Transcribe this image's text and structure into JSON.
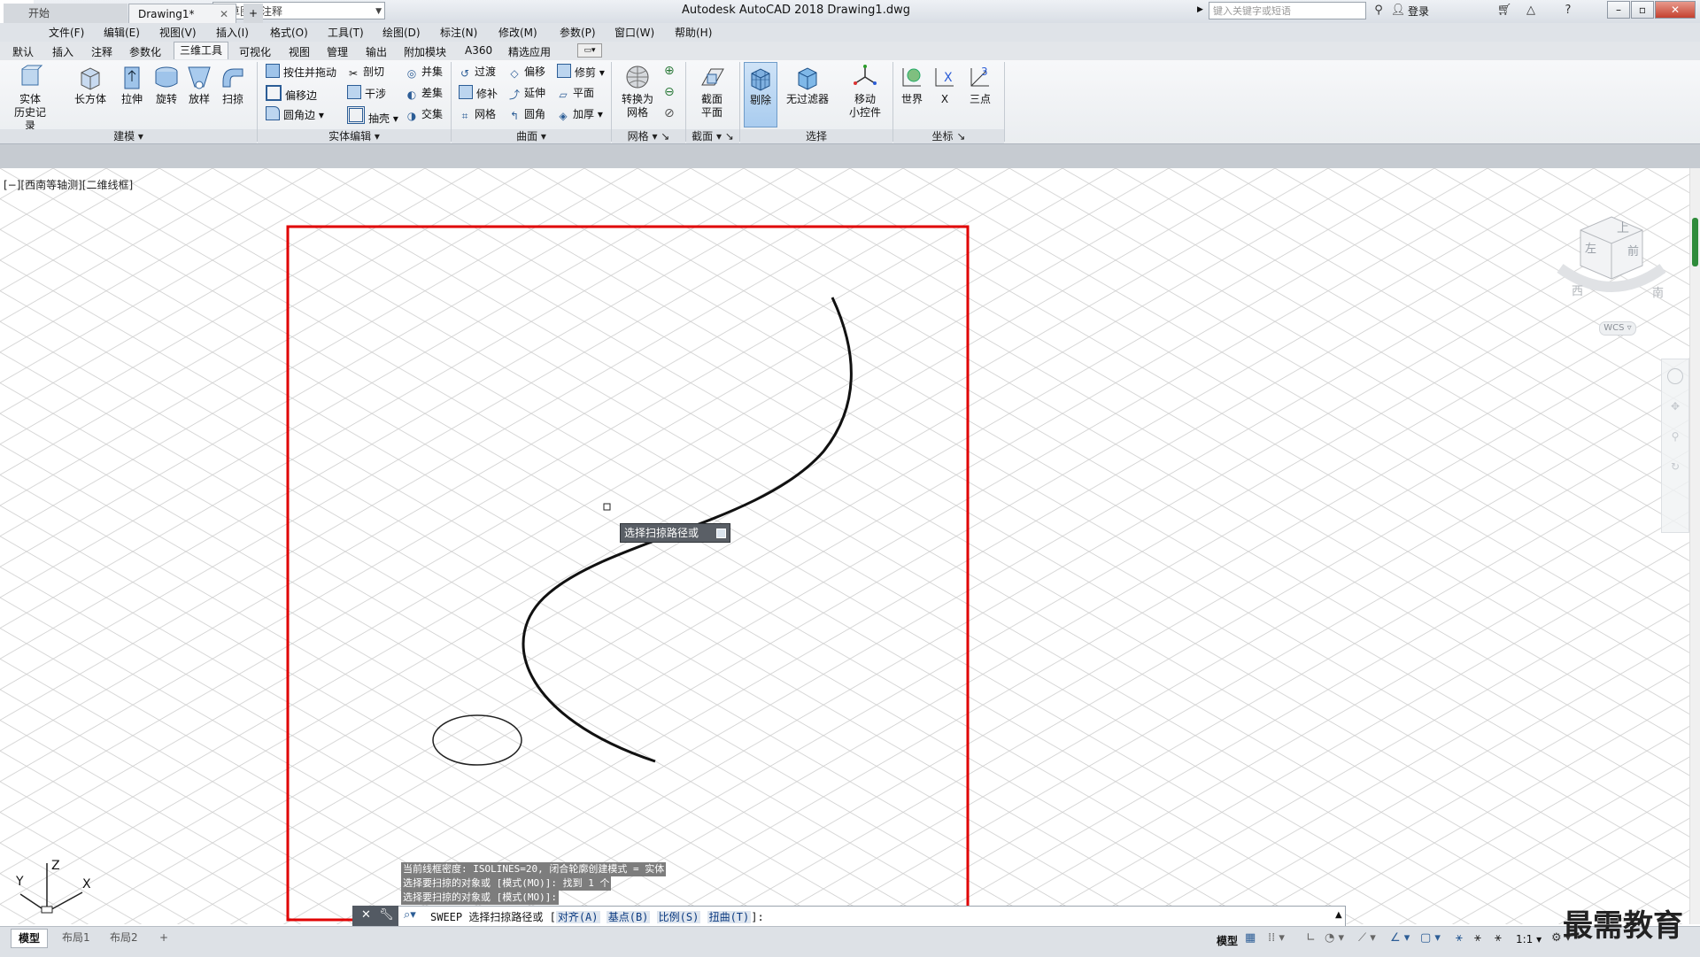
{
  "app": {
    "title": "Autodesk AutoCAD 2018    Drawing1.dwg",
    "workspace": "草图与注释",
    "search_placeholder": "键入关键字或短语",
    "login": "登录"
  },
  "menu": [
    "文件(F)",
    "编辑(E)",
    "视图(V)",
    "插入(I)",
    "格式(O)",
    "工具(T)",
    "绘图(D)",
    "标注(N)",
    "修改(M)",
    "参数(P)",
    "窗口(W)",
    "帮助(H)"
  ],
  "ribbon_tabs": [
    "默认",
    "插入",
    "注释",
    "参数化",
    "三维工具",
    "可视化",
    "视图",
    "管理",
    "输出",
    "附加模块",
    "A360",
    "精选应用"
  ],
  "ribbon_active_tab": "三维工具",
  "ribbon": {
    "history": "实体\n历史记录",
    "box": "长方体",
    "extrude": "拉伸",
    "revolve": "旋转",
    "loft": "放样",
    "sweep": "扫掠",
    "modeling_label": "建模",
    "press_pull": "按住并拖动",
    "offset_edge": "偏移边",
    "fillet_edge": "圆角边",
    "slice": "剖切",
    "interfere": "干涉",
    "shell": "抽壳",
    "union": "并集",
    "subtract": "差集",
    "intersect": "交集",
    "solid_edit_label": "实体编辑",
    "blend": "过渡",
    "patch": "修补",
    "network": "网格",
    "offset": "偏移",
    "extend": "延伸",
    "fillet": "圆角",
    "trim": "修剪",
    "planar": "平面",
    "thicken": "加厚",
    "surface_label": "曲面",
    "convert_mesh": "转换为\n网格",
    "mesh_label": "网格",
    "section_plane": "截面\n平面",
    "section_label": "截面",
    "culling": "剔除",
    "no_filter": "无过滤器",
    "move_gizmo": "移动\n小控件",
    "select_label": "选择",
    "world": "世界",
    "x": "X",
    "three_point": "三点",
    "coords_label": "坐标"
  },
  "file_tabs": {
    "start": "开始",
    "drawing": "Drawing1*"
  },
  "viewport_label": "[−][西南等轴测][二维线框]",
  "tooltip": "选择扫掠路径或",
  "viewcube": {
    "top": "上",
    "left": "左",
    "front": "前",
    "west": "西",
    "south": "南",
    "wcs": "WCS"
  },
  "ucs": {
    "x": "X",
    "y": "Y",
    "z": "Z"
  },
  "command": {
    "history": [
      "当前线框密度:  ISOLINES=20, 闭合轮廓创建模式 = 实体",
      "选择要扫掠的对象或 [模式(MO)]: 找到 1 个",
      "选择要扫掠的对象或 [模式(MO)]:"
    ],
    "prompt_prefix": "SWEEP 选择扫掠路径或 [",
    "opt1": "对齐(A)",
    "opt2": "基点(B)",
    "opt3": "比例(S)",
    "opt4": "扭曲(T)",
    "prompt_suffix": "]:"
  },
  "layout_tabs": [
    "模型",
    "布局1",
    "布局2"
  ],
  "status": {
    "model": "模型",
    "scale": "1:1"
  },
  "watermark": "最需教育",
  "colors": {
    "highlight_box": "#e00000",
    "selected": "#a9ccef"
  }
}
